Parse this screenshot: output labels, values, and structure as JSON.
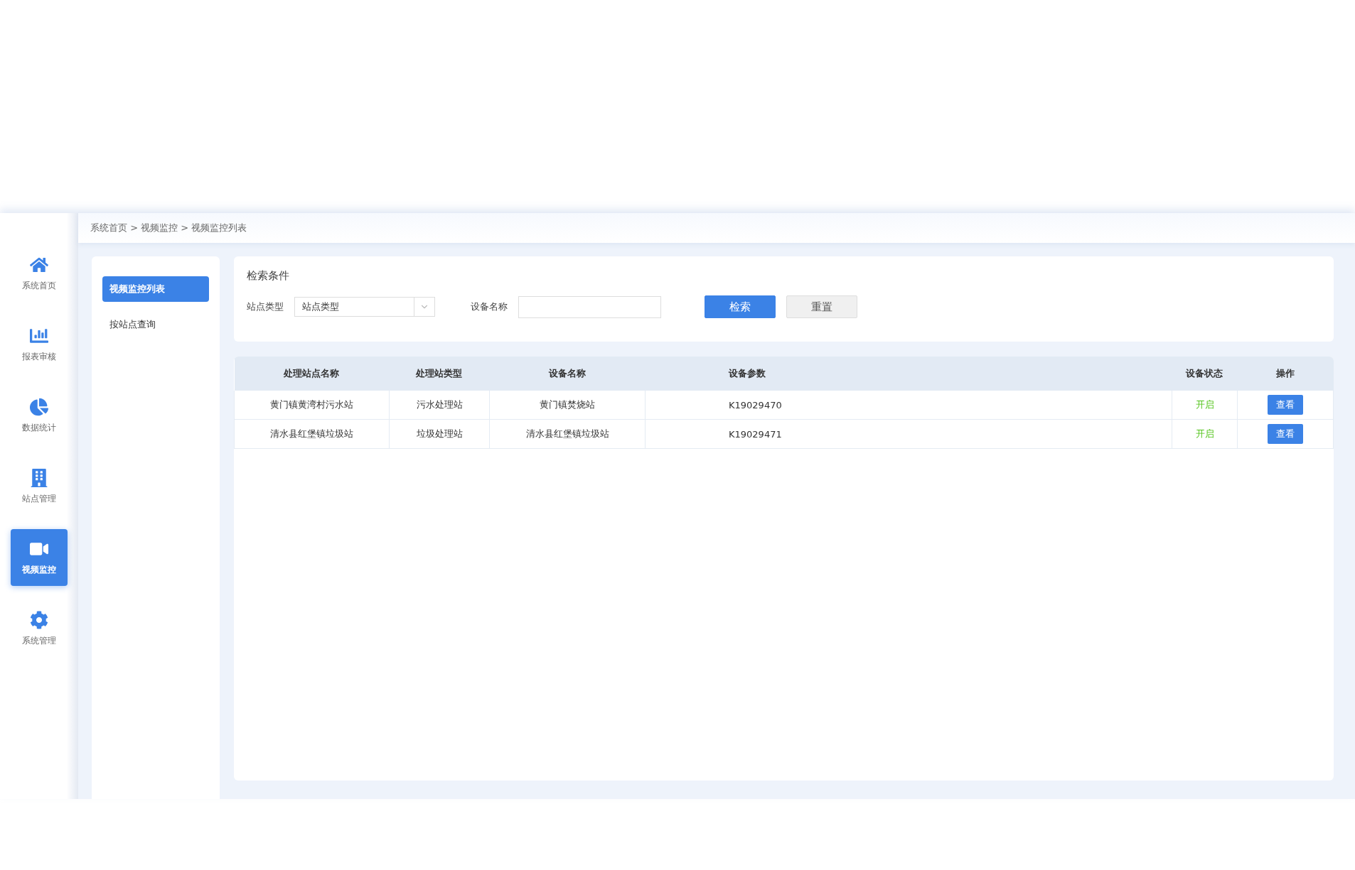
{
  "breadcrumb": "系统首页 > 视频监控 > 视频监控列表",
  "sidebar": {
    "items": [
      {
        "label": "系统首页",
        "kind": "home",
        "selected": false
      },
      {
        "label": "报表审核",
        "kind": "report",
        "selected": false
      },
      {
        "label": "数据统计",
        "kind": "pie",
        "selected": false
      },
      {
        "label": "站点管理",
        "kind": "building",
        "selected": false
      },
      {
        "label": "视频监控",
        "kind": "camera",
        "selected": true
      },
      {
        "label": "系统管理",
        "kind": "gear",
        "selected": false
      }
    ]
  },
  "submenu": {
    "items": [
      {
        "label": "视频监控列表",
        "selected": true
      },
      {
        "label": "按站点查询",
        "selected": false
      }
    ]
  },
  "search": {
    "title": "检索条件",
    "station_type": {
      "label": "站点类型",
      "value": "站点类型"
    },
    "device_name": {
      "label": "设备名称"
    },
    "buttons": [
      {
        "label": "检索",
        "kind": "primary"
      },
      {
        "label": "重置",
        "kind": "default"
      }
    ]
  },
  "table": {
    "columns": [
      "处理站点名称",
      "处理站类型",
      "设备名称",
      "设备参数",
      "设备状态",
      "操作"
    ],
    "rows": [
      {
        "station": "黄门镇黄湾村污水站",
        "type": "污水处理站",
        "device": "黄门镇焚烧站",
        "param": "K19029470",
        "status": "开启",
        "on": true,
        "action": "查看"
      },
      {
        "station": "清水县红堡镇垃圾站",
        "type": "垃圾处理站",
        "device": "清水县红堡镇垃圾站",
        "param": "K19029471",
        "status": "开启",
        "on": true,
        "action": "查看"
      }
    ]
  }
}
